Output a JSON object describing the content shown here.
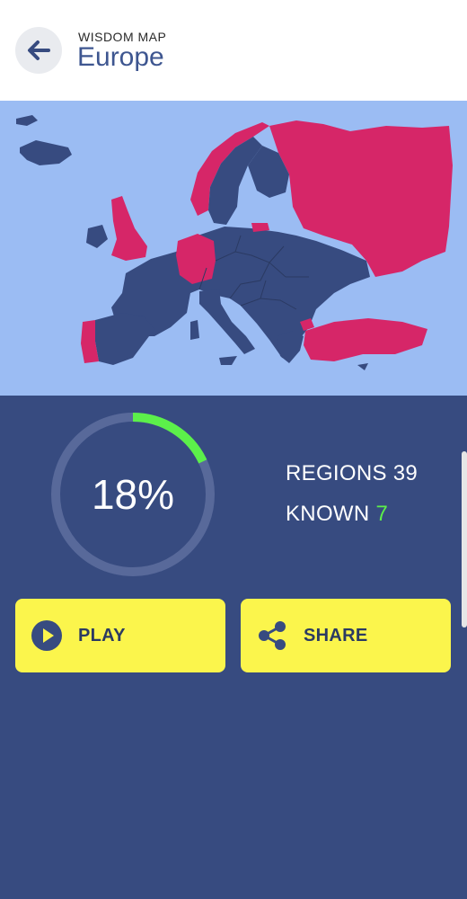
{
  "header": {
    "kicker": "WISDOM MAP",
    "title": "Europe",
    "back_icon": "arrow-left-icon"
  },
  "map": {
    "known_color": "#d62668",
    "unknown_color": "#374b80",
    "water_color": "#9bbcf3"
  },
  "stats": {
    "progress": {
      "percent_label": "18%",
      "fraction": 0.18
    },
    "regions_label": "REGIONS",
    "regions_value": "39",
    "known_label": "KNOWN",
    "known_value": "7"
  },
  "actions": {
    "play_label": "PLAY",
    "share_label": "SHARE",
    "play_icon": "play-circle-icon",
    "share_icon": "share-icon"
  },
  "colors": {
    "button_bg": "#fbf54c",
    "progress_fill": "#5cf04a",
    "progress_track": "#58699a",
    "panel_bg": "#374b80"
  }
}
